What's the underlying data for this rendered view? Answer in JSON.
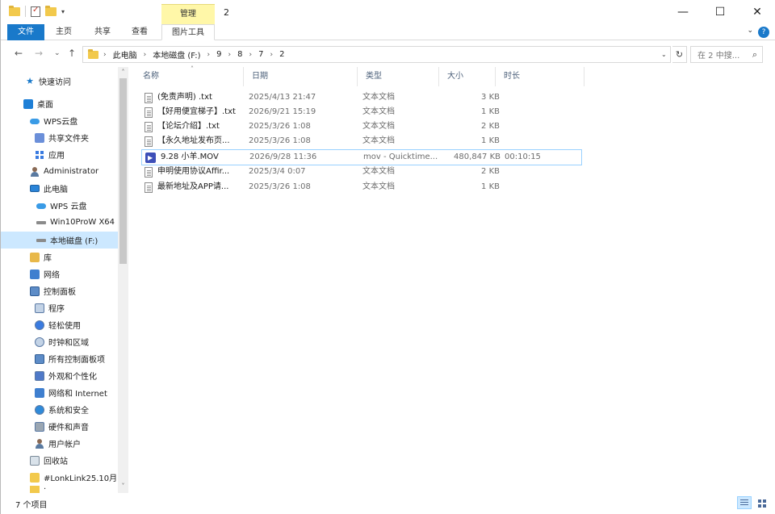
{
  "window": {
    "title": "2",
    "contextual_tab": "管理",
    "minimize_icon": "—",
    "maximize_icon": "☐",
    "close_icon": "✕"
  },
  "ribbon": {
    "tabs": [
      {
        "label": "文件"
      },
      {
        "label": "主页"
      },
      {
        "label": "共享"
      },
      {
        "label": "查看"
      },
      {
        "label": "图片工具"
      }
    ],
    "expand_icon": "⌄",
    "help_icon": "?"
  },
  "navigation": {
    "back_icon": "←",
    "forward_icon": "→",
    "recent_icon": "⌄",
    "up_icon": "↑",
    "breadcrumb": [
      "此电脑",
      "本地磁盘 (F:)",
      "9",
      "8",
      "7",
      "2"
    ],
    "separator": "›",
    "dropdown_icon": "⌄",
    "refresh_icon": "↻",
    "search_placeholder": "在 2 中搜...",
    "search_icon": "⌕"
  },
  "nav_pane": {
    "items": [
      {
        "label": "快速访问",
        "icon": "star-icon"
      },
      {
        "label": "桌面",
        "icon": "desktop-icon"
      },
      {
        "label": "WPS云盘",
        "icon": "cloud-icon"
      },
      {
        "label": "共享文件夹",
        "icon": "shared-folder-icon"
      },
      {
        "label": "应用",
        "icon": "apps-icon"
      },
      {
        "label": "Administrator",
        "icon": "user-icon"
      },
      {
        "label": "此电脑",
        "icon": "pc-icon"
      },
      {
        "label": "WPS 云盘",
        "icon": "cloud-icon"
      },
      {
        "label": "Win10ProW X64",
        "icon": "drive-icon"
      },
      {
        "label": "本地磁盘 (F:)",
        "icon": "drive-icon",
        "selected": true
      },
      {
        "label": "库",
        "icon": "library-icon"
      },
      {
        "label": "网络",
        "icon": "network-icon"
      },
      {
        "label": "控制面板",
        "icon": "control-panel-icon"
      },
      {
        "label": "程序",
        "icon": "programs-icon"
      },
      {
        "label": "轻松使用",
        "icon": "ease-of-access-icon"
      },
      {
        "label": "时钟和区域",
        "icon": "clock-region-icon"
      },
      {
        "label": "所有控制面板项",
        "icon": "all-control-panel-icon"
      },
      {
        "label": "外观和个性化",
        "icon": "appearance-icon"
      },
      {
        "label": "网络和 Internet",
        "icon": "network-internet-icon"
      },
      {
        "label": "系统和安全",
        "icon": "system-security-icon"
      },
      {
        "label": "硬件和声音",
        "icon": "hardware-sound-icon"
      },
      {
        "label": "用户帐户",
        "icon": "user-accounts-icon"
      },
      {
        "label": "回收站",
        "icon": "recycle-bin-icon"
      },
      {
        "label": "#LonkLink25.10月",
        "icon": "folder-icon"
      },
      {
        "label": "·",
        "icon": "folder-icon"
      }
    ],
    "scroll_up_icon": "˄",
    "scroll_down_icon": "˅"
  },
  "file_list": {
    "columns": [
      {
        "label": "名称"
      },
      {
        "label": "日期"
      },
      {
        "label": "类型"
      },
      {
        "label": "大小"
      },
      {
        "label": "时长"
      }
    ],
    "sort_indicator": "˄",
    "rows": [
      {
        "name": "(免责声明) .txt",
        "date": "2025/4/13 21:47",
        "type": "文本文档",
        "size": "3 KB",
        "duration": "",
        "kind": "text"
      },
      {
        "name": "【好用便宜梯子】.txt",
        "date": "2026/9/21 15:19",
        "type": "文本文档",
        "size": "1 KB",
        "duration": "",
        "kind": "text"
      },
      {
        "name": "【论坛介绍】.txt",
        "date": "2025/3/26 1:08",
        "type": "文本文档",
        "size": "2 KB",
        "duration": "",
        "kind": "text"
      },
      {
        "name": "【永久地址发布页...",
        "date": "2025/3/26 1:08",
        "type": "文本文档",
        "size": "1 KB",
        "duration": "",
        "kind": "text"
      },
      {
        "name": "9.28 小羊.MOV",
        "date": "2026/9/28 11:36",
        "type": "mov - Quicktime...",
        "size": "480,847 KB",
        "duration": "00:10:15",
        "kind": "video",
        "selected": true
      },
      {
        "name": "申明使用协议Affir...",
        "date": "2025/3/4 0:07",
        "type": "文本文档",
        "size": "2 KB",
        "duration": "",
        "kind": "text"
      },
      {
        "name": "最新地址及APP请...",
        "date": "2025/3/26 1:08",
        "type": "文本文档",
        "size": "1 KB",
        "duration": "",
        "kind": "text"
      }
    ]
  },
  "status_bar": {
    "item_count": "7 个项目"
  }
}
